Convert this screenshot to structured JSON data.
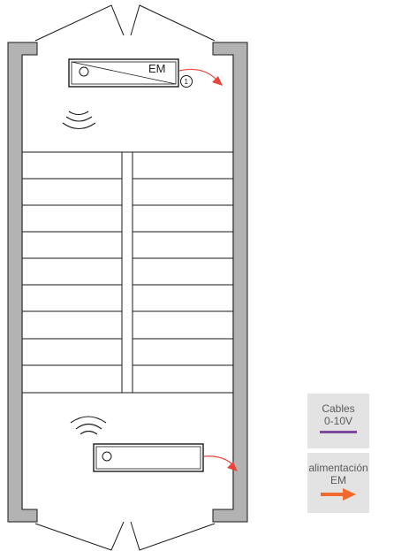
{
  "colors": {
    "wall": "#b3b3b3",
    "line": "#1a1a1a",
    "arrow": "#e8463a",
    "cable_purple": "#7d4a9e",
    "power_orange": "#f06a2b",
    "legend_bg": "#e3e3e3"
  },
  "fixture_top": {
    "label": "EM",
    "callout": "1"
  },
  "legend": {
    "cables_line1": "Cables",
    "cables_line2": "0-10V",
    "power_line1": "alimentación",
    "power_line2": "EM"
  }
}
